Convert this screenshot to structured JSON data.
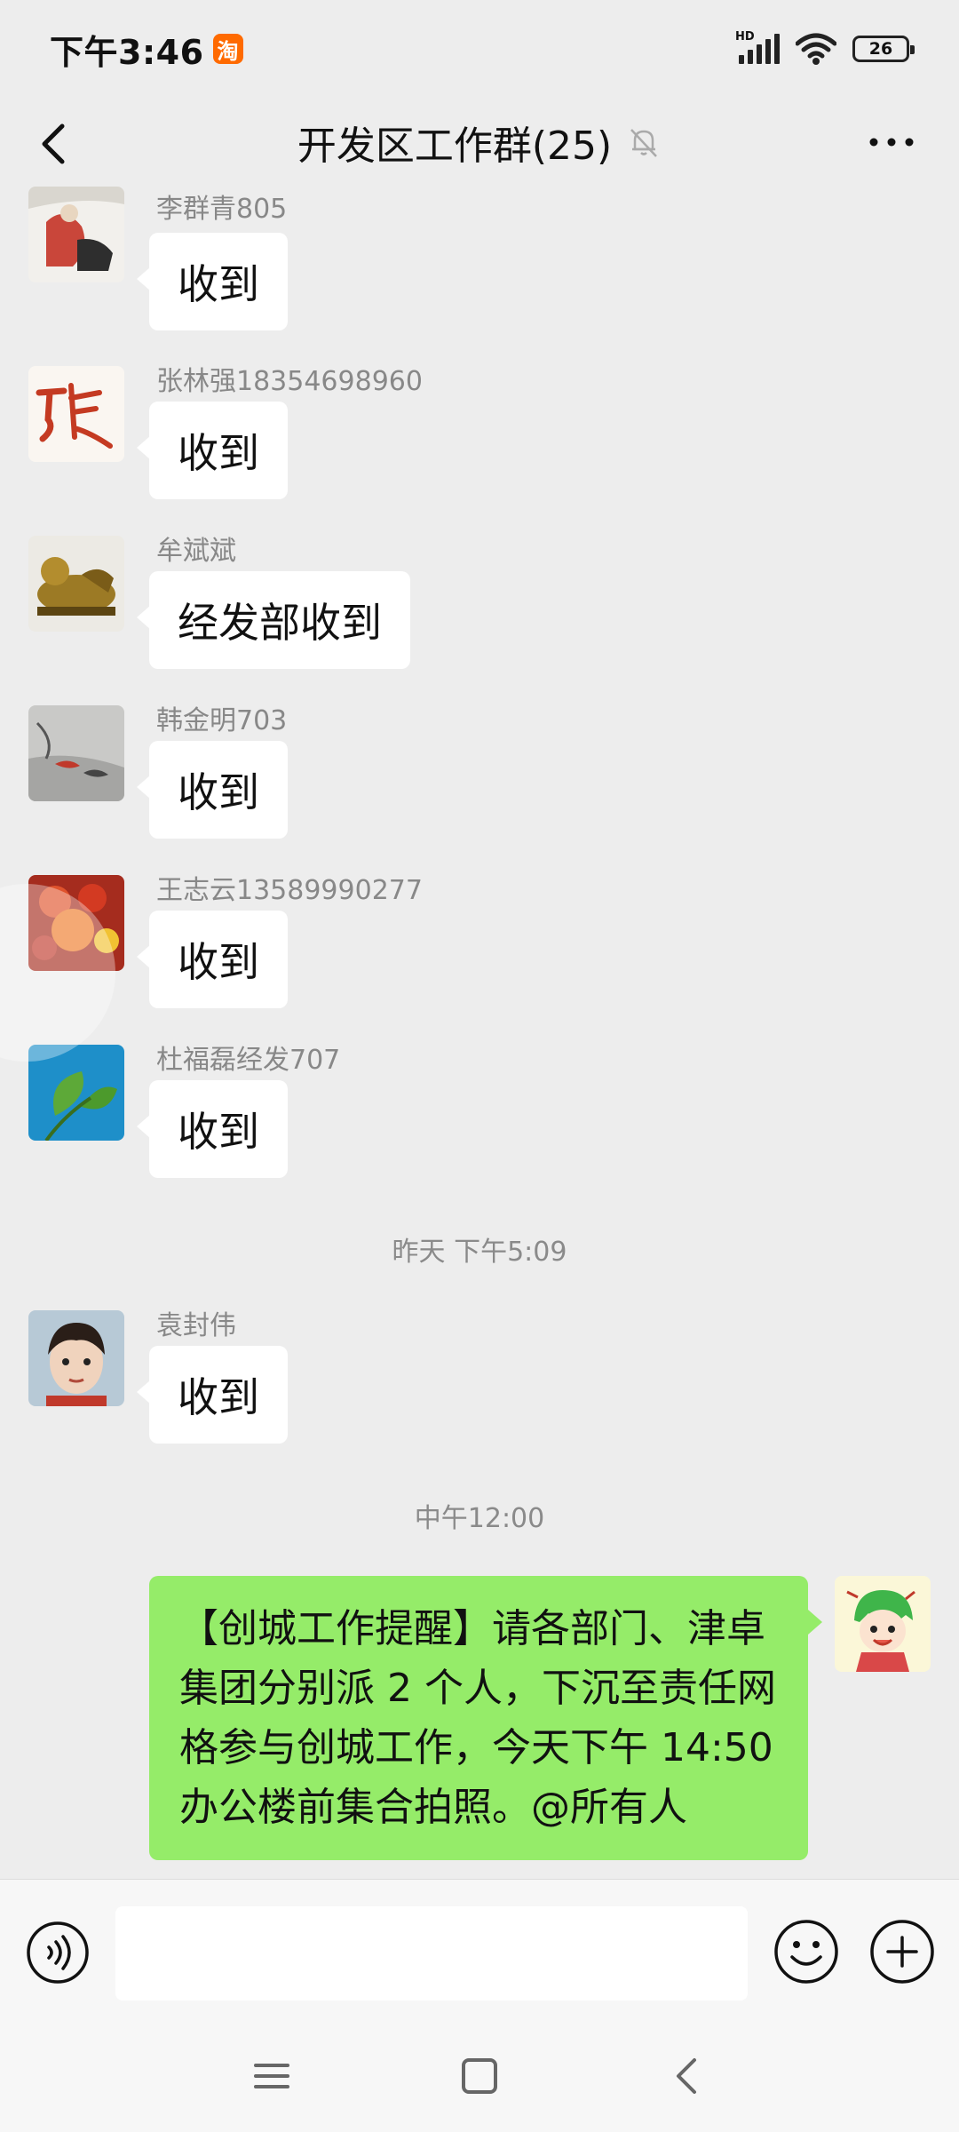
{
  "status_bar": {
    "time": "下午3:46",
    "taobao_badge": "淘",
    "network": "HD",
    "battery": "26"
  },
  "header": {
    "title": "开发区工作群(25)"
  },
  "messages": [
    {
      "sender": "李群青805",
      "text": "收到"
    },
    {
      "sender": "张林强18354698960",
      "text": "收到"
    },
    {
      "sender": "牟斌斌",
      "text": "经发部收到"
    },
    {
      "sender": "韩金明703",
      "text": "收到"
    },
    {
      "sender": "王志云13589990277",
      "text": "收到"
    },
    {
      "sender": "杜福磊经发707",
      "text": "收到"
    },
    {
      "sender": "袁封伟",
      "text": "收到"
    }
  ],
  "time_separators": [
    "昨天 下午5:09",
    "中午12:00"
  ],
  "my_message": {
    "lines": [
      "【创城工作提醒】请各部门、津卓",
      "集团分别派 2 个人，下沉至责任网",
      "格参与创城工作，今天下午 14:50",
      "办公楼前集合拍照。@所有人"
    ]
  },
  "input": {
    "value": "",
    "placeholder": ""
  },
  "colors": {
    "background": "#ededed",
    "my_bubble": "#95ec69",
    "other_bubble": "#ffffff",
    "taobao": "#ff6a00"
  }
}
